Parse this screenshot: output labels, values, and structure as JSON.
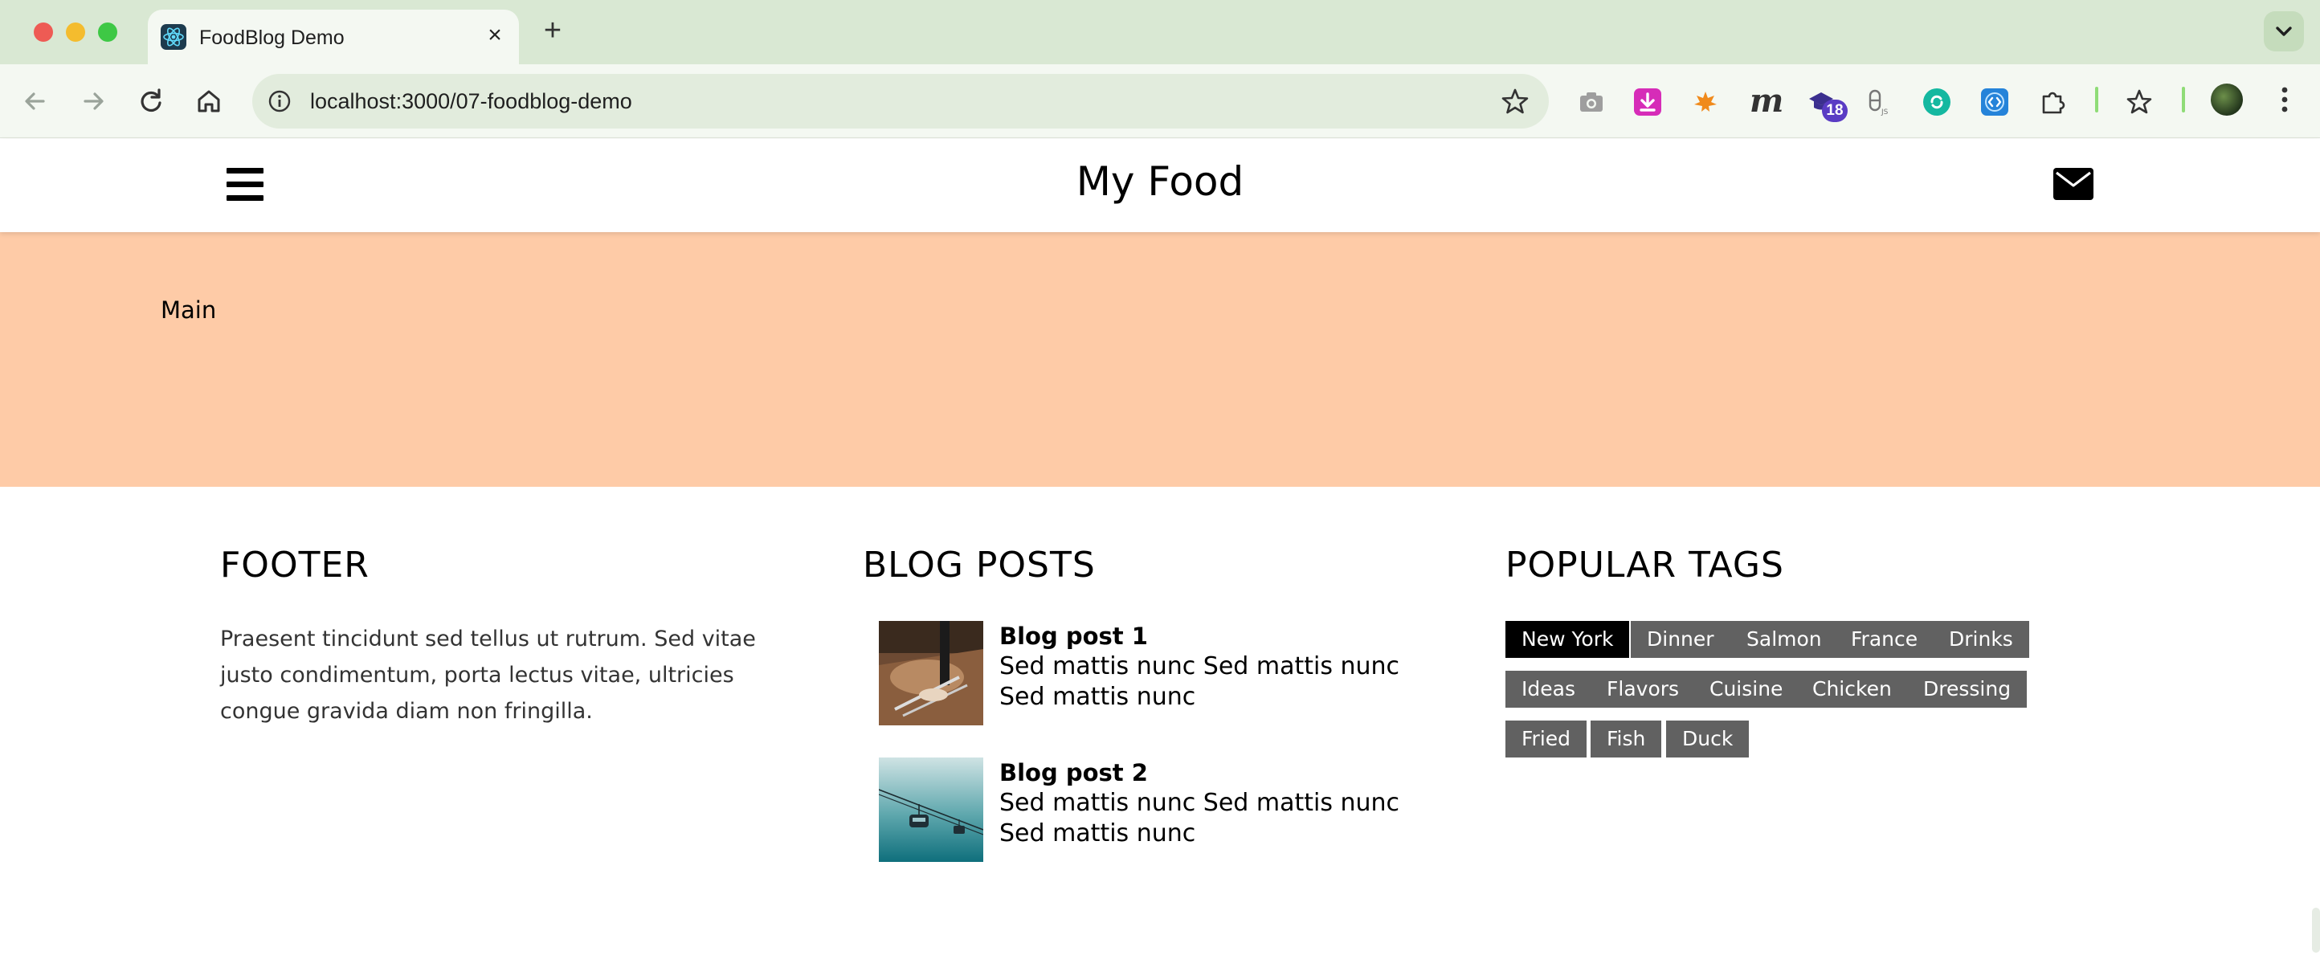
{
  "browser": {
    "tab_title": "FoodBlog Demo",
    "tab_close": "×",
    "new_tab": "+",
    "url": "localhost:3000/07-foodblog-demo",
    "extension_badge": "18",
    "ext_m_label": "m",
    "icons": [
      "react-icon",
      "back-icon",
      "forward-icon",
      "reload-icon",
      "home-icon",
      "info-icon",
      "star-icon",
      "camera-icon",
      "download-icon",
      "leaf-icon",
      "m-icon",
      "graduation-cap-icon",
      "nodejs-icon",
      "refresh-circle-icon",
      "code-icon",
      "puzzle-icon",
      "star-list-icon",
      "avatar",
      "kebab-icon"
    ]
  },
  "header": {
    "title": "My Food",
    "menu_icon": "hamburger-icon",
    "contact_icon": "envelope-icon"
  },
  "main": {
    "label": "Main",
    "background": "#fecba7"
  },
  "footer": {
    "heading": "FOOTER",
    "text": "Praesent tincidunt sed tellus ut rutrum. Sed vitae justo condimentum, porta lectus vitae, ultricies congue gravida diam non fringilla."
  },
  "blog_posts": {
    "heading": "BLOG POSTS",
    "posts": [
      {
        "title": "Blog post 1",
        "text": "Sed mattis nunc Sed mattis nunc Sed mattis nunc"
      },
      {
        "title": "Blog post 2",
        "text": "Sed mattis nunc Sed mattis nunc Sed mattis nunc"
      }
    ]
  },
  "popular_tags": {
    "heading": "POPULAR TAGS",
    "active": "New York",
    "tags": [
      "New York",
      "Dinner",
      "Salmon",
      "France",
      "Drinks",
      "Ideas",
      "Flavors",
      "Cuisine",
      "Chicken",
      "Dressing",
      "Fried",
      "Fish",
      "Duck"
    ]
  },
  "colors": {
    "tag_bg": "#616161",
    "tag_active_bg": "#000000",
    "tabbar_bg": "#d9e8d3"
  }
}
